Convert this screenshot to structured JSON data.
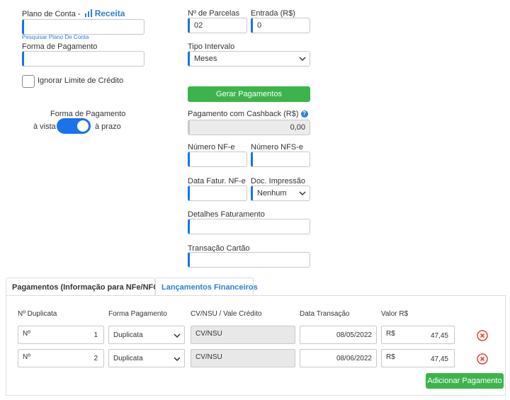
{
  "left": {
    "plano_label": "Plano de Conta -",
    "plano_type": "Receita",
    "plano_value": "",
    "pesquisar_link": "Pesquisar Plano De Conta",
    "forma_label": "Forma de Pagamento",
    "forma_value": "",
    "ignorar_label": "Ignorar Limite de Crédito",
    "toggle_title": "Forma de Pagamento",
    "toggle_left": "à vista",
    "toggle_right": "à prazo"
  },
  "right": {
    "parcelas_label": "Nº de Parcelas",
    "parcelas_value": "02",
    "entrada_label": "Entrada (R$)",
    "entrada_value": "0",
    "intervalo_label": "Tipo Intervalo",
    "intervalo_value": "Meses",
    "gerar_button": "Gerar Pagamentos",
    "cashback_label": "Pagamento com Cashback (R$)",
    "cashback_help": "?",
    "cashback_value": "0,00",
    "nfe_label": "Número NF-e",
    "nfe_value": "",
    "nfse_label": "Número NFS-e",
    "nfse_value": "",
    "data_fatur_label": "Data Fatur. NF-e",
    "data_fatur_value": "",
    "doc_label": "Doc. Impressão",
    "doc_value": "Nenhum",
    "detalhes_label": "Detalhes Faturamento",
    "detalhes_value": "",
    "transacao_label": "Transação Cartão",
    "transacao_value": ""
  },
  "tabs": [
    {
      "label": "Pagamentos (Informação para NFe/NFCe)",
      "active": true
    },
    {
      "label": "Lançamentos Financeiros",
      "active": false
    }
  ],
  "table": {
    "headers": [
      "Nº Duplicata",
      "Forma Pagamento",
      "CV/NSU / Vale Crédito",
      "Data Transação",
      "Valor R$"
    ],
    "rows": [
      {
        "dup_prefix": "Nº",
        "dup_num": "1",
        "forma": "Duplicata",
        "cvnsu": "CV/NSU",
        "data": "08/05/2022",
        "cur": "R$",
        "valor": "47,45"
      },
      {
        "dup_prefix": "Nº",
        "dup_num": "2",
        "forma": "Duplicata",
        "cvnsu": "CV/NSU",
        "data": "08/06/2022",
        "cur": "R$",
        "valor": "47,45"
      }
    ],
    "add_button": "Adicionar Pagamento"
  },
  "colors": {
    "accent": "#1a73e8",
    "green": "#3cb44b",
    "link": "#2a7fd4",
    "remove": "#e0473a"
  }
}
